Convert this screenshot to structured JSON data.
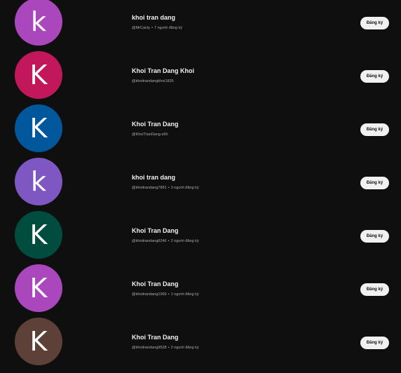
{
  "subscribe_label": "Đăng ký",
  "meta_separator": "•",
  "channels": [
    {
      "avatar_letter": "k",
      "avatar_color": "#ab47bc",
      "name": "khoi tran dang",
      "handle": "@MrCacty",
      "subscribers": "7 người đăng ký"
    },
    {
      "avatar_letter": "K",
      "avatar_color": "#c2185b",
      "name": "Khoi Tran Dang Khoi",
      "handle": "@khoitrandangkhoi1835",
      "subscribers": ""
    },
    {
      "avatar_letter": "K",
      "avatar_color": "#01579b",
      "name": "Khoi Tran Dang",
      "handle": "@KhoiTranDang-z6h",
      "subscribers": ""
    },
    {
      "avatar_letter": "k",
      "avatar_color": "#7e57c2",
      "name": "khoi tran dang",
      "handle": "@khoitrandang7891",
      "subscribers": "3 người đăng ký"
    },
    {
      "avatar_letter": "K",
      "avatar_color": "#004d40",
      "name": "Khoi Tran Dang",
      "handle": "@khoitrandang6246",
      "subscribers": "2 người đăng ký"
    },
    {
      "avatar_letter": "K",
      "avatar_color": "#ab47bc",
      "name": "Khoi Tran Dang",
      "handle": "@khoitrandang1069",
      "subscribers": "1 người đăng ký"
    },
    {
      "avatar_letter": "K",
      "avatar_color": "#5d4037",
      "name": "Khoi Tran Dang",
      "handle": "@khoitrandang9528",
      "subscribers": "2 người đăng ký"
    }
  ]
}
